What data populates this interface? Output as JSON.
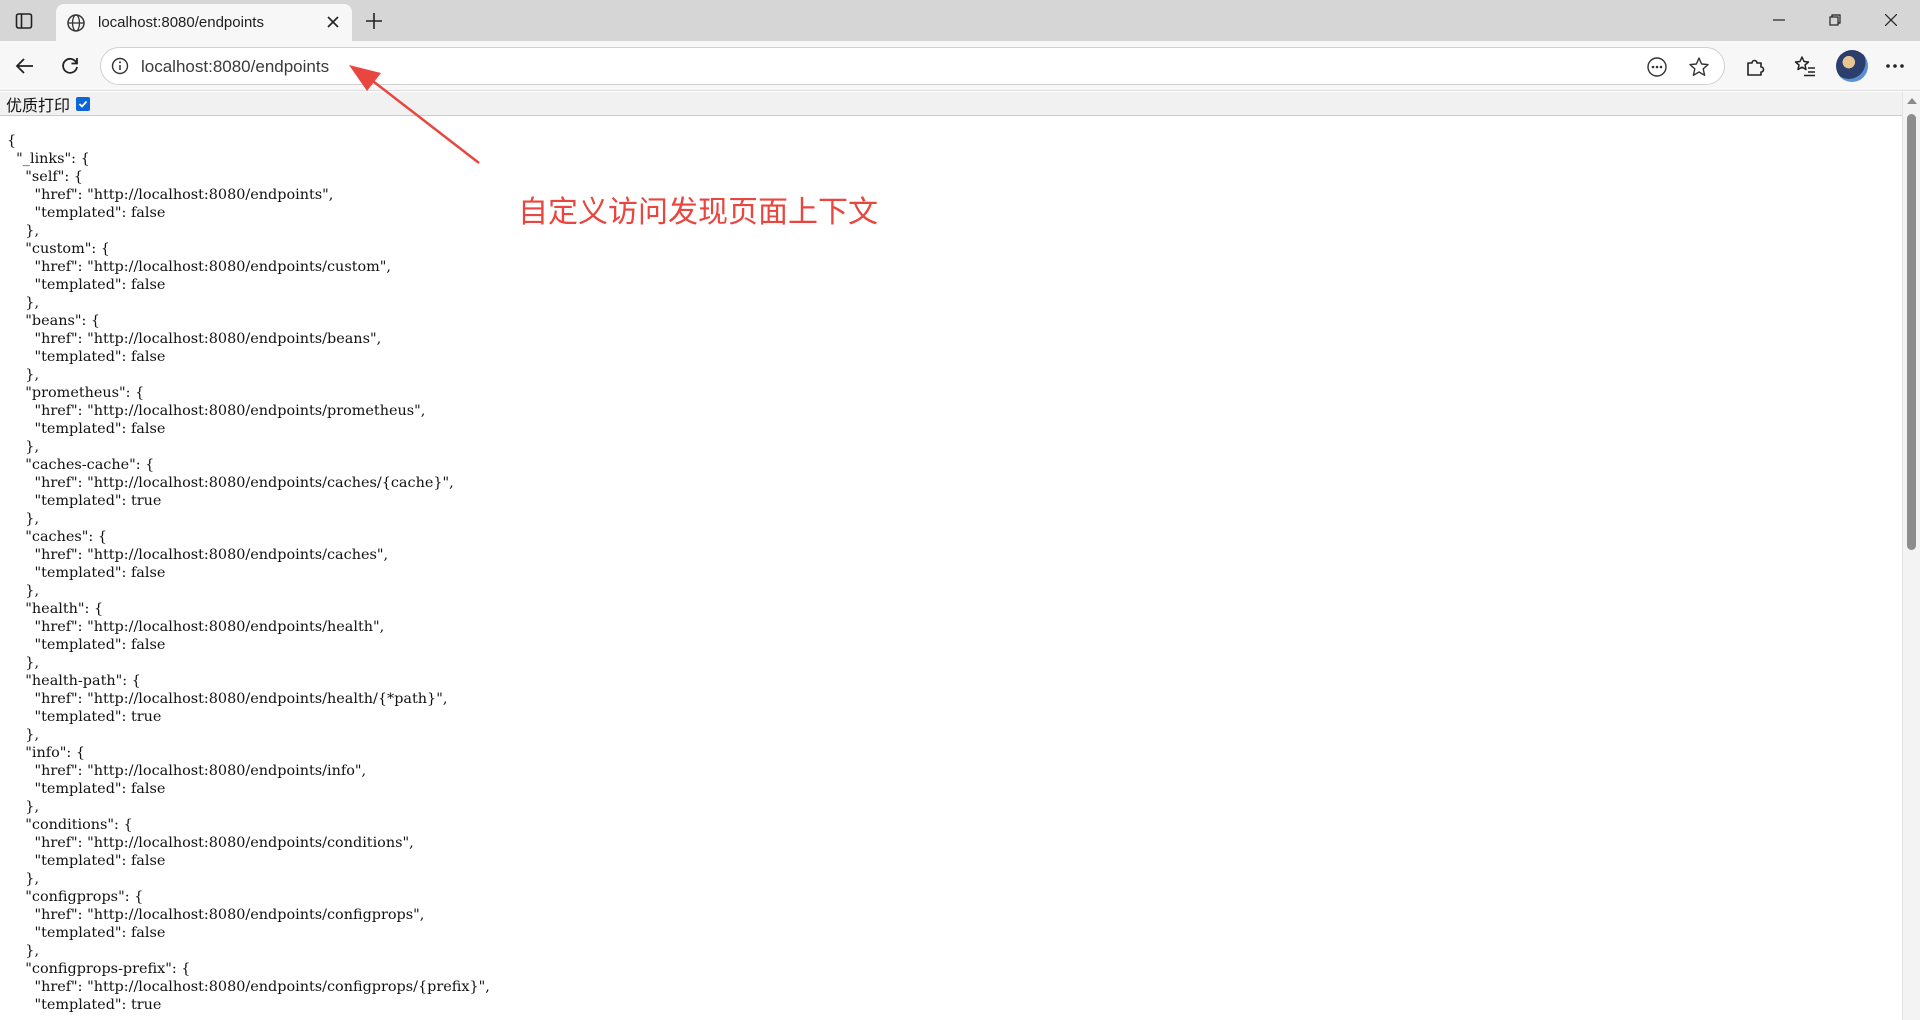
{
  "browser": {
    "tab": {
      "title": "localhost:8080/endpoints",
      "favicon": "globe-icon"
    },
    "url": "localhost:8080/endpoints",
    "icons": {
      "tab_actions": "tab-actions-icon",
      "new_tab": "plus-icon",
      "back": "back-arrow-icon",
      "reload": "reload-icon",
      "site_info": "info-icon",
      "read_aloud": "more-dots-icon",
      "favorite": "star-icon",
      "extensions": "puzzle-icon",
      "favorites_hub": "favorites-list-icon",
      "menu": "ellipsis-icon"
    },
    "window": {
      "minimize": "minimize-icon",
      "restore": "restore-icon",
      "close": "close-icon"
    }
  },
  "page": {
    "pretty_print_label": "优质打印",
    "pretty_print_checked": true,
    "json_lines": [
      "{",
      "  \"_links\": {",
      "    \"self\": {",
      "      \"href\": \"http://localhost:8080/endpoints\",",
      "      \"templated\": false",
      "    },",
      "    \"custom\": {",
      "      \"href\": \"http://localhost:8080/endpoints/custom\",",
      "      \"templated\": false",
      "    },",
      "    \"beans\": {",
      "      \"href\": \"http://localhost:8080/endpoints/beans\",",
      "      \"templated\": false",
      "    },",
      "    \"prometheus\": {",
      "      \"href\": \"http://localhost:8080/endpoints/prometheus\",",
      "      \"templated\": false",
      "    },",
      "    \"caches-cache\": {",
      "      \"href\": \"http://localhost:8080/endpoints/caches/{cache}\",",
      "      \"templated\": true",
      "    },",
      "    \"caches\": {",
      "      \"href\": \"http://localhost:8080/endpoints/caches\",",
      "      \"templated\": false",
      "    },",
      "    \"health\": {",
      "      \"href\": \"http://localhost:8080/endpoints/health\",",
      "      \"templated\": false",
      "    },",
      "    \"health-path\": {",
      "      \"href\": \"http://localhost:8080/endpoints/health/{*path}\",",
      "      \"templated\": true",
      "    },",
      "    \"info\": {",
      "      \"href\": \"http://localhost:8080/endpoints/info\",",
      "      \"templated\": false",
      "    },",
      "    \"conditions\": {",
      "      \"href\": \"http://localhost:8080/endpoints/conditions\",",
      "      \"templated\": false",
      "    },",
      "    \"configprops\": {",
      "      \"href\": \"http://localhost:8080/endpoints/configprops\",",
      "      \"templated\": false",
      "    },",
      "    \"configprops-prefix\": {",
      "      \"href\": \"http://localhost:8080/endpoints/configprops/{prefix}\",",
      "      \"templated\": true"
    ],
    "annotation": "自定义访问发现页面上下文",
    "annotation_color": "#e8463f"
  }
}
